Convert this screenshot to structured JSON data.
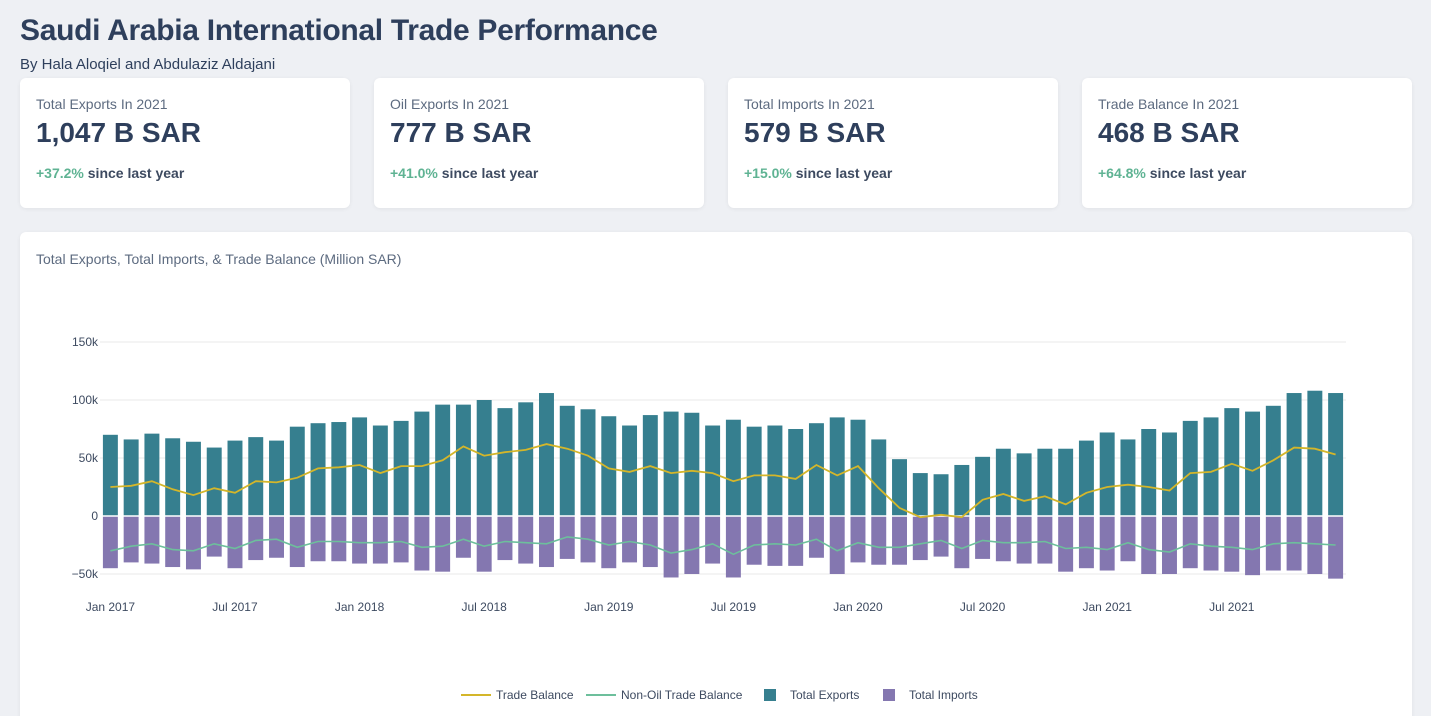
{
  "header": {
    "title": "Saudi Arabia International Trade Performance",
    "subtitle": "By Hala Aloqiel and Abdulaziz Aldajani"
  },
  "kpis": [
    {
      "label": "Total Exports In 2021",
      "value": "1,047 B SAR",
      "change": "+37.2%",
      "suffix": "since last year"
    },
    {
      "label": "Oil Exports In 2021",
      "value": "777 B SAR",
      "change": "+41.0%",
      "suffix": "since last year"
    },
    {
      "label": "Total Imports In 2021",
      "value": "579 B SAR",
      "change": "+15.0%",
      "suffix": "since last year"
    },
    {
      "label": "Trade Balance In 2021",
      "value": "468 B SAR",
      "change": "+64.8%",
      "suffix": "since last year"
    }
  ],
  "colors": {
    "exports": "#367f8f",
    "imports": "#8477b0",
    "trade_balance": "#d4b62a",
    "non_oil_balance": "#6dbf9c",
    "positive_change": "#5fb393"
  },
  "chart_data": {
    "type": "bar",
    "title": "Total Exports, Total Imports, & Trade Balance (Million SAR)",
    "x": [
      "2017-01",
      "2017-02",
      "2017-03",
      "2017-04",
      "2017-05",
      "2017-06",
      "2017-07",
      "2017-08",
      "2017-09",
      "2017-10",
      "2017-11",
      "2017-12",
      "2018-01",
      "2018-02",
      "2018-03",
      "2018-04",
      "2018-05",
      "2018-06",
      "2018-07",
      "2018-08",
      "2018-09",
      "2018-10",
      "2018-11",
      "2018-12",
      "2019-01",
      "2019-02",
      "2019-03",
      "2019-04",
      "2019-05",
      "2019-06",
      "2019-07",
      "2019-08",
      "2019-09",
      "2019-10",
      "2019-11",
      "2019-12",
      "2020-01",
      "2020-02",
      "2020-03",
      "2020-04",
      "2020-05",
      "2020-06",
      "2020-07",
      "2020-08",
      "2020-09",
      "2020-10",
      "2020-11",
      "2020-12",
      "2021-01",
      "2021-02",
      "2021-03",
      "2021-04",
      "2021-05",
      "2021-06",
      "2021-07",
      "2021-08",
      "2021-09",
      "2021-10",
      "2021-11",
      "2021-12"
    ],
    "x_ticks": [
      "Jan 2017",
      "Jul 2017",
      "Jan 2018",
      "Jul 2018",
      "Jan 2019",
      "Jul 2019",
      "Jan 2020",
      "Jul 2020",
      "Jan 2021",
      "Jul 2021"
    ],
    "y_ticks": [
      "150k",
      "100k",
      "50k",
      "0",
      "−50k"
    ],
    "ylim": [
      -50000,
      150000
    ],
    "grid": true,
    "legend_position": "bottom-center",
    "series": [
      {
        "name": "Total Exports",
        "kind": "bar",
        "values": [
          70000,
          66000,
          71000,
          67000,
          64000,
          59000,
          65000,
          68000,
          65000,
          77000,
          80000,
          81000,
          85000,
          78000,
          82000,
          90000,
          96000,
          96000,
          100000,
          93000,
          98000,
          106000,
          95000,
          92000,
          86000,
          78000,
          87000,
          90000,
          89000,
          78000,
          83000,
          77000,
          78000,
          75000,
          80000,
          85000,
          83000,
          66000,
          49000,
          37000,
          36000,
          44000,
          51000,
          58000,
          54000,
          58000,
          58000,
          65000,
          72000,
          66000,
          75000,
          72000,
          82000,
          85000,
          93000,
          90000,
          95000,
          106000,
          108000,
          106000
        ]
      },
      {
        "name": "Total Imports",
        "kind": "bar",
        "values": [
          -45000,
          -40000,
          -41000,
          -44000,
          -46000,
          -35000,
          -45000,
          -38000,
          -36000,
          -44000,
          -39000,
          -39000,
          -41000,
          -41000,
          -40000,
          -47000,
          -48000,
          -36000,
          -48000,
          -38000,
          -41000,
          -44000,
          -37000,
          -40000,
          -45000,
          -40000,
          -44000,
          -53000,
          -50000,
          -41000,
          -53000,
          -42000,
          -43000,
          -43000,
          -36000,
          -50000,
          -40000,
          -42000,
          -42000,
          -38000,
          -35000,
          -45000,
          -37000,
          -39000,
          -41000,
          -41000,
          -48000,
          -45000,
          -47000,
          -39000,
          -50000,
          -50000,
          -45000,
          -47000,
          -48000,
          -51000,
          -47000,
          -47000,
          -50000,
          -54000
        ]
      },
      {
        "name": "Trade Balance",
        "kind": "line",
        "values": [
          25000,
          26000,
          30000,
          23000,
          18000,
          24000,
          20000,
          30000,
          29000,
          33000,
          41000,
          42000,
          44000,
          37000,
          43000,
          43000,
          48000,
          60000,
          52000,
          55000,
          57000,
          62000,
          58000,
          52000,
          41000,
          38000,
          43000,
          37000,
          39000,
          37000,
          30000,
          35000,
          35000,
          32000,
          44000,
          35000,
          43000,
          24000,
          7000,
          -1000,
          1000,
          -1000,
          14000,
          19000,
          13000,
          17000,
          10000,
          20000,
          25000,
          27000,
          25000,
          22000,
          37000,
          38000,
          45000,
          39000,
          48000,
          59000,
          58000,
          53000
        ]
      },
      {
        "name": "Non-Oil Trade Balance",
        "kind": "line",
        "values": [
          -30000,
          -26000,
          -24000,
          -29000,
          -30000,
          -24000,
          -28000,
          -21000,
          -20000,
          -27000,
          -22000,
          -22000,
          -23000,
          -23000,
          -22000,
          -27000,
          -26000,
          -20000,
          -26000,
          -22000,
          -23000,
          -24000,
          -18000,
          -20000,
          -25000,
          -22000,
          -25000,
          -32000,
          -29000,
          -24000,
          -33000,
          -25000,
          -24000,
          -25000,
          -20000,
          -30000,
          -23000,
          -27000,
          -27000,
          -24000,
          -21000,
          -28000,
          -21000,
          -23000,
          -23000,
          -22000,
          -28000,
          -27000,
          -29000,
          -23000,
          -29000,
          -31000,
          -24000,
          -26000,
          -27000,
          -29000,
          -24000,
          -23000,
          -24000,
          -25000
        ]
      }
    ]
  }
}
